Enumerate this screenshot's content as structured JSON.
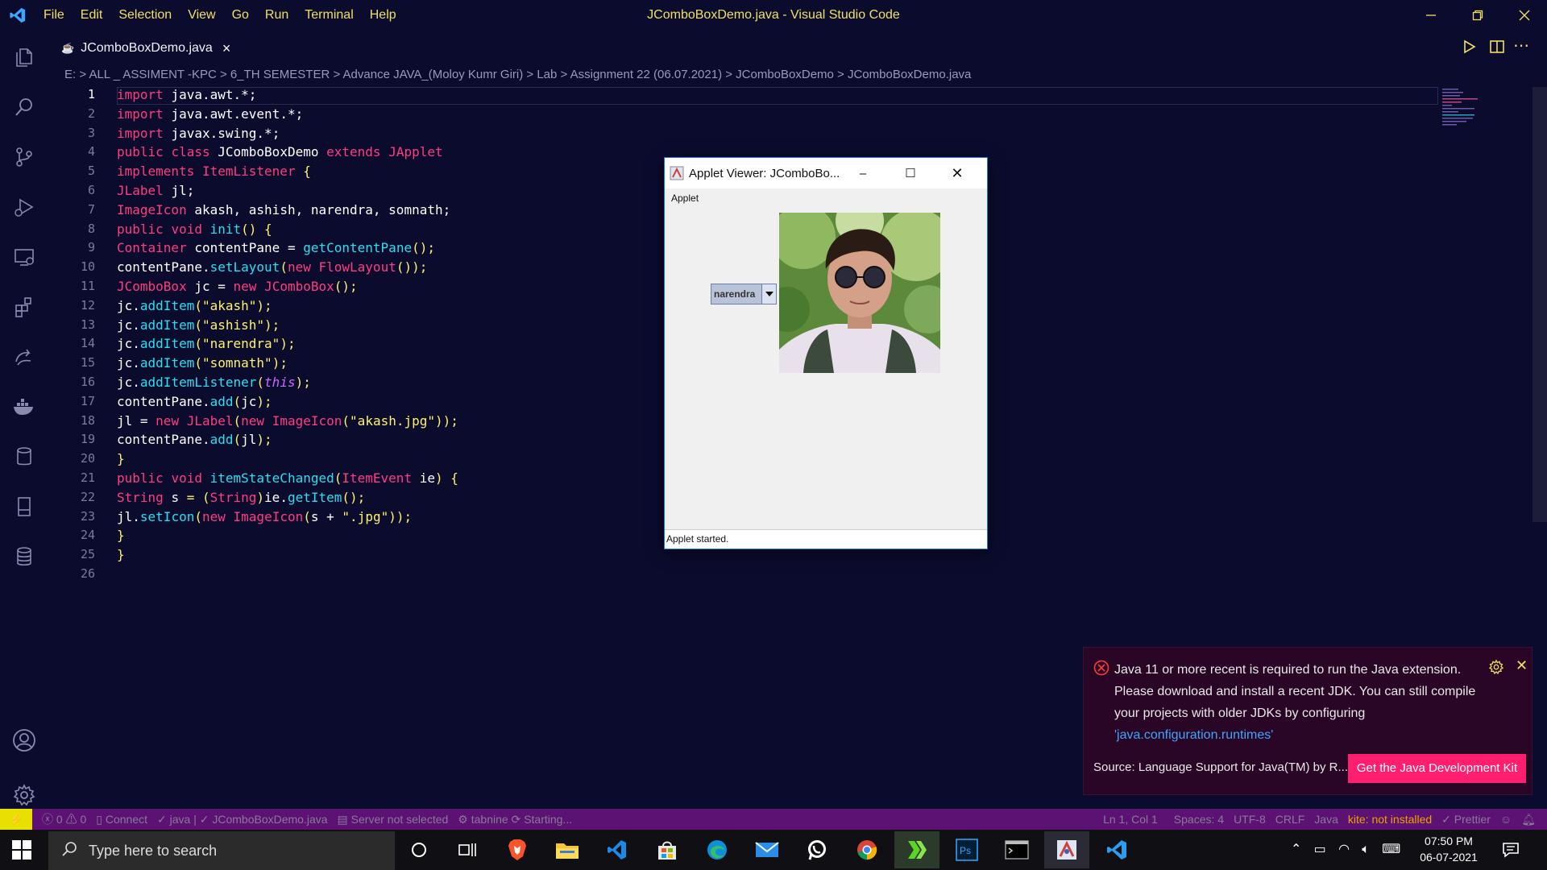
{
  "window": {
    "title": "JComboBoxDemo.java - Visual Studio Code",
    "menu": [
      "File",
      "Edit",
      "Selection",
      "View",
      "Go",
      "Run",
      "Terminal",
      "Help"
    ]
  },
  "tab": {
    "label": "JComboBoxDemo.java"
  },
  "breadcrumb": "E: > ALL _ ASSIMENT -KPC > 6_TH SEMESTER > Advance JAVA_(Moloy Kumr Giri) > Lab > Assignment 22 (06.07.2021) > JComboBoxDemo > JComboBoxDemo.java",
  "editor": {
    "current_line": 1,
    "line_numbers": [
      "1",
      "2",
      "3",
      "4",
      "5",
      "6",
      "7",
      "8",
      "9",
      "10",
      "11",
      "12",
      "13",
      "14",
      "15",
      "16",
      "17",
      "18",
      "19",
      "20",
      "21",
      "22",
      "23",
      "24",
      "25",
      "26"
    ],
    "lines": [
      "import java.awt.*;",
      "import java.awt.event.*;",
      "import javax.swing.*;",
      "public class JComboBoxDemo extends JApplet",
      "implements ItemListener {",
      "JLabel jl;",
      "ImageIcon akash, ashish, narendra, somnath;",
      "public void init() {",
      "Container contentPane = getContentPane();",
      "contentPane.setLayout(new FlowLayout());",
      "JComboBox jc = new JComboBox();",
      "jc.addItem(\"akash\");",
      "jc.addItem(\"ashish\");",
      "jc.addItem(\"narendra\");",
      "jc.addItem(\"somnath\");",
      "jc.addItemListener(this);",
      "contentPane.add(jc);",
      "jl = new JLabel(new ImageIcon(\"akash.jpg\"));",
      "contentPane.add(jl);",
      "}",
      "public void itemStateChanged(ItemEvent ie) {",
      "String s = (String)ie.getItem();",
      "jl.setIcon(new ImageIcon(s + \".jpg\"));",
      "}",
      "}",
      ""
    ]
  },
  "applet": {
    "title": "Applet Viewer: JComboBo...",
    "menu": "Applet",
    "combo_value": "narendra",
    "status": "Applet started."
  },
  "notification": {
    "message": "Java 11 or more recent is required to run the Java extension. Please download and install a recent JDK. You can still compile your projects with older JDKs by configuring",
    "link": "'java.configuration.runtimes'",
    "source": "Source: Language Support for Java(TM) by R...",
    "button": "Get the Java Development Kit"
  },
  "statusbar": {
    "problems": "0",
    "warnings": "0",
    "connect": "Connect",
    "java": "java | ✓ JComboBoxDemo.java",
    "server": "Server not selected",
    "tabnine": "tabnine",
    "starting": "Starting...",
    "position": "Ln 1, Col 1",
    "spaces": "Spaces: 4",
    "encoding": "UTF-8",
    "eol": "CRLF",
    "language": "Java",
    "kite": "kite: not installed",
    "prettier": "Prettier"
  },
  "taskbar": {
    "search_placeholder": "Type here to search",
    "time": "07:50 PM",
    "date": "06-07-2021"
  },
  "colors": {
    "background": "#0b0b2e",
    "statusbar": "#5b1272",
    "menu_text": "#f0e060",
    "keyword": "#ff3d7f",
    "function": "#28e0f0",
    "string": "#fff36b",
    "jdk_button": "#ff1f6e"
  }
}
